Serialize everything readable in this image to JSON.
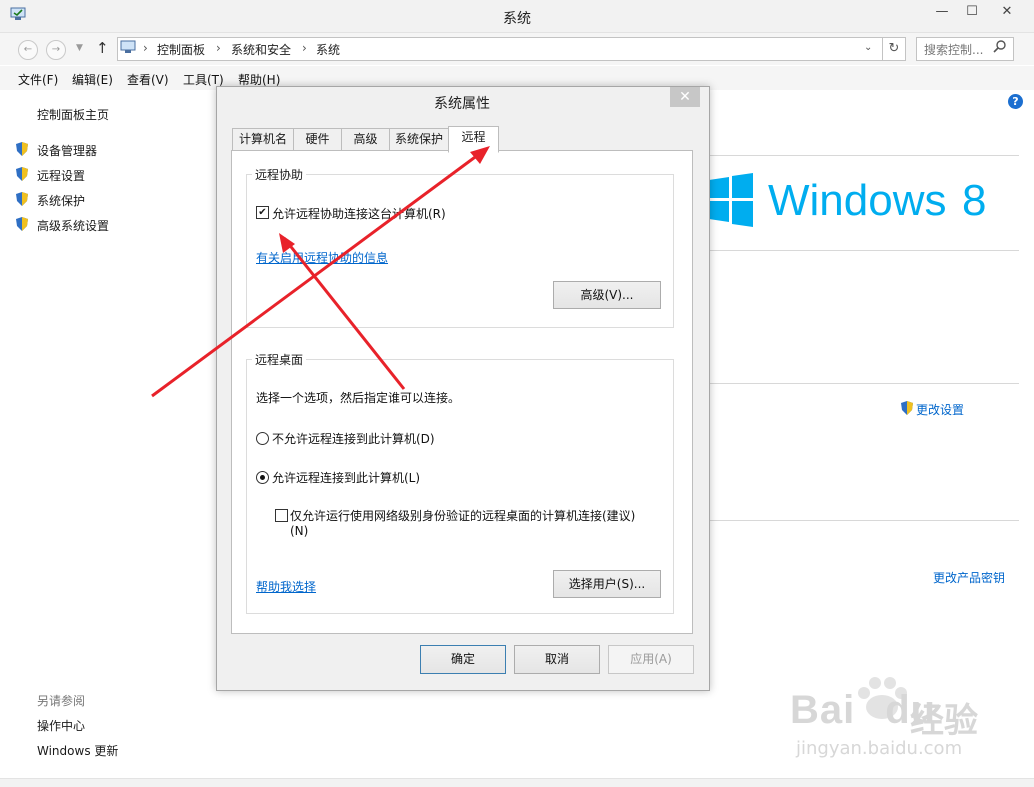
{
  "window": {
    "title": "系统",
    "min": "—",
    "max": "☐",
    "close": "✕"
  },
  "address": {
    "crumbs": [
      "控制面板",
      "系统和安全",
      "系统"
    ],
    "sep": "›",
    "search_placeholder": "搜索控制..."
  },
  "menu": [
    "文件(F)",
    "编辑(E)",
    "查看(V)",
    "工具(T)",
    "帮助(H)"
  ],
  "sidebar": {
    "home": "控制面板主页",
    "items": [
      "设备管理器",
      "远程设置",
      "系统保护",
      "高级系统设置"
    ],
    "see_also": "另请参阅",
    "see_also_items": [
      "操作中心",
      "Windows 更新"
    ]
  },
  "right": {
    "windows_text": "Windows",
    "windows_ver": "8",
    "change_settings": "更改设置",
    "change_key": "更改产品密钥",
    "help": "?"
  },
  "dialog": {
    "title": "系统属性",
    "close": "✕",
    "tabs": [
      "计算机名",
      "硬件",
      "高级",
      "系统保护",
      "远程"
    ],
    "assist": {
      "group": "远程协助",
      "checkbox": "允许远程协助连接这台计算机(R)",
      "checked": true,
      "link": "有关启用远程协助的信息",
      "advanced": "高级(V)..."
    },
    "desktop": {
      "group": "远程桌面",
      "desc": "选择一个选项，然后指定谁可以连接。",
      "opt1": "不允许远程连接到此计算机(D)",
      "opt2": "允许远程连接到此计算机(L)",
      "selected": 2,
      "nla_line1": "仅允许运行使用网络级别身份验证的远程桌面的计算机连接(建议)",
      "nla_line2": "(N)",
      "nla_checked": false,
      "help_link": "帮助我选择",
      "select_users": "选择用户(S)..."
    },
    "ok": "确定",
    "cancel": "取消",
    "apply": "应用(A)"
  },
  "watermark": {
    "brand": "Bai",
    "brand2": "du",
    "brand_cn": "经验",
    "url": "jingyan.baidu.com"
  },
  "colors": {
    "windows_blue": "#00adef",
    "arrow_red": "#e8222a",
    "link": "#0066cc"
  }
}
